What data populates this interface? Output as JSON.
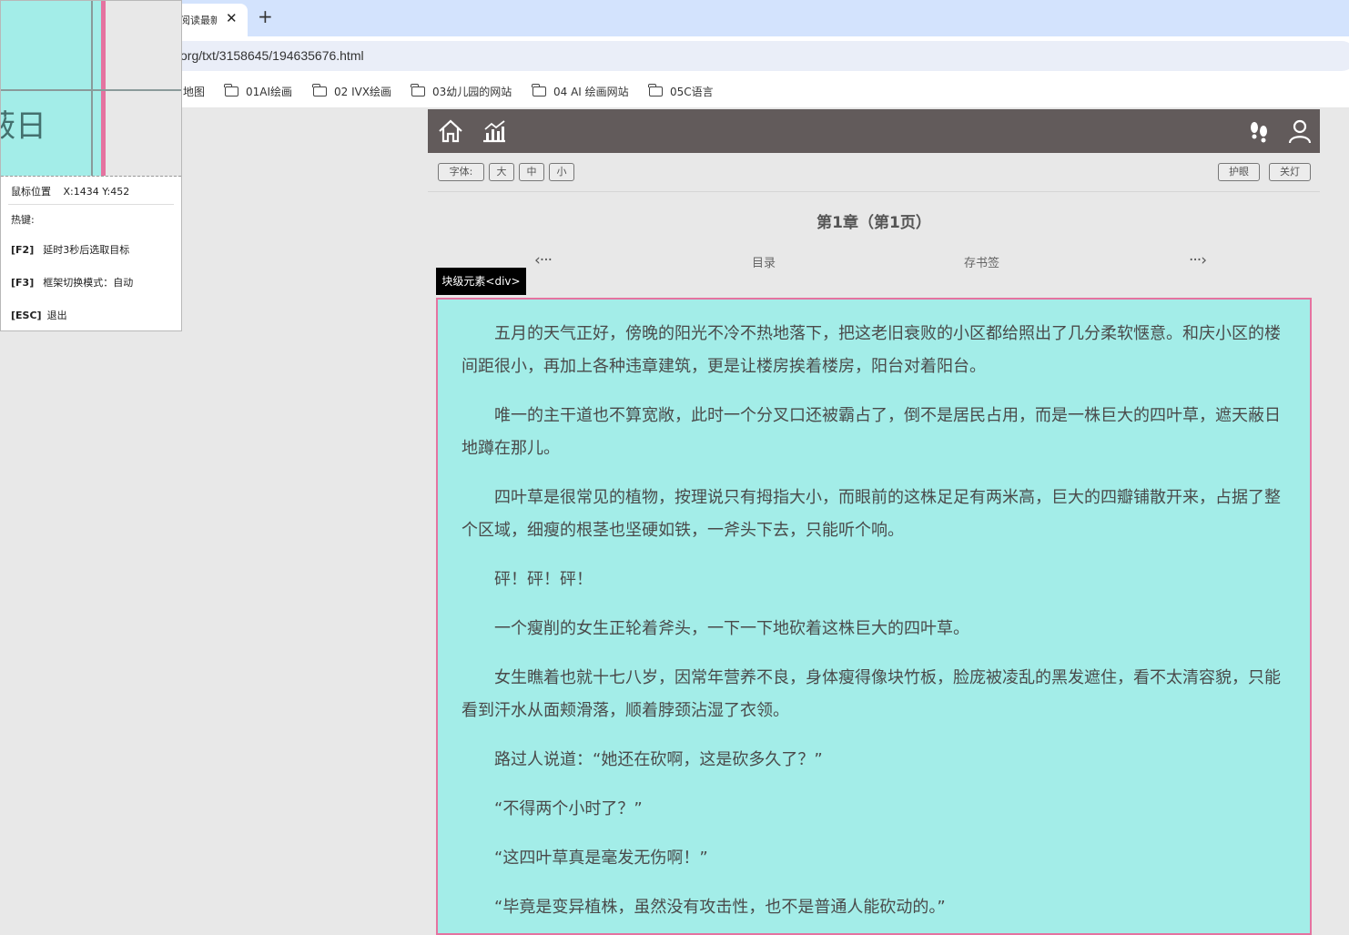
{
  "browser": {
    "tab_title": "阅读最新",
    "tab_close": "✕",
    "new_tab": "+",
    "url": "org/txt/3158645/194635676.html",
    "bookmarks": [
      {
        "label": "地图",
        "folder": false
      },
      {
        "label": "01AI绘画",
        "folder": true
      },
      {
        "label": "02 IVX绘画",
        "folder": true
      },
      {
        "label": "03幼儿园的网站",
        "folder": true
      },
      {
        "label": "04 AI 绘画网站",
        "folder": true
      },
      {
        "label": "05C语言",
        "folder": true
      }
    ]
  },
  "reader": {
    "header_icons": [
      "home-icon",
      "chart-icon",
      "footprints-icon",
      "user-icon"
    ],
    "toolbar": {
      "font_label": "字体:",
      "large": "大",
      "medium": "中",
      "small": "小",
      "eye_care": "护眼",
      "lights_off": "关灯"
    },
    "chapter_title": "第1章（第1页）",
    "nav": {
      "prev": "‹···",
      "toc": "目录",
      "bookmark": "存书签",
      "next": "···›"
    },
    "paragraphs": [
      "五月的天气正好，傍晚的阳光不冷不热地落下，把这老旧衰败的小区都给照出了几分柔软惬意。和庆小区的楼间距很小，再加上各种违章建筑，更是让楼房挨着楼房，阳台对着阳台。",
      "唯一的主干道也不算宽敞，此时一个分叉口还被霸占了，倒不是居民占用，而是一株巨大的四叶草，遮天蔽日地蹲在那儿。",
      "四叶草是很常见的植物，按理说只有拇指大小，而眼前的这株足足有两米高，巨大的四瓣铺散开来，占据了整个区域，细瘦的根茎也坚硬如铁，一斧头下去，只能听个响。",
      "砰！砰！砰！",
      "一个瘦削的女生正轮着斧头，一下一下地砍着这株巨大的四叶草。",
      "女生瞧着也就十七八岁，因常年营养不良，身体瘦得像块竹板，脸庞被凌乱的黑发遮住，看不太清容貌，只能看到汗水从面颊滑落，顺着脖颈沾湿了衣领。",
      "路过人说道：“她还在砍啊，这是砍多久了？”",
      "“不得两个小时了？”",
      "“这四叶草真是毫发无伤啊！”",
      "“毕竟是变异植株，虽然没有攻击性，也不是普通人能砍动的。”"
    ]
  },
  "overlay": {
    "element_tag": "块级元素<div>",
    "magnifier_text": "蔽日",
    "mouse_label": "鼠标位置",
    "mouse_pos": "X:1434 Y:452",
    "hotkeys_label": "热键:",
    "hotkeys": [
      {
        "key": "[F2]",
        "desc": "延时3秒后选取目标"
      },
      {
        "key": "[F3]",
        "desc": "框架切换模式：自动"
      },
      {
        "key": "[ESC]",
        "desc": "退出"
      }
    ]
  }
}
